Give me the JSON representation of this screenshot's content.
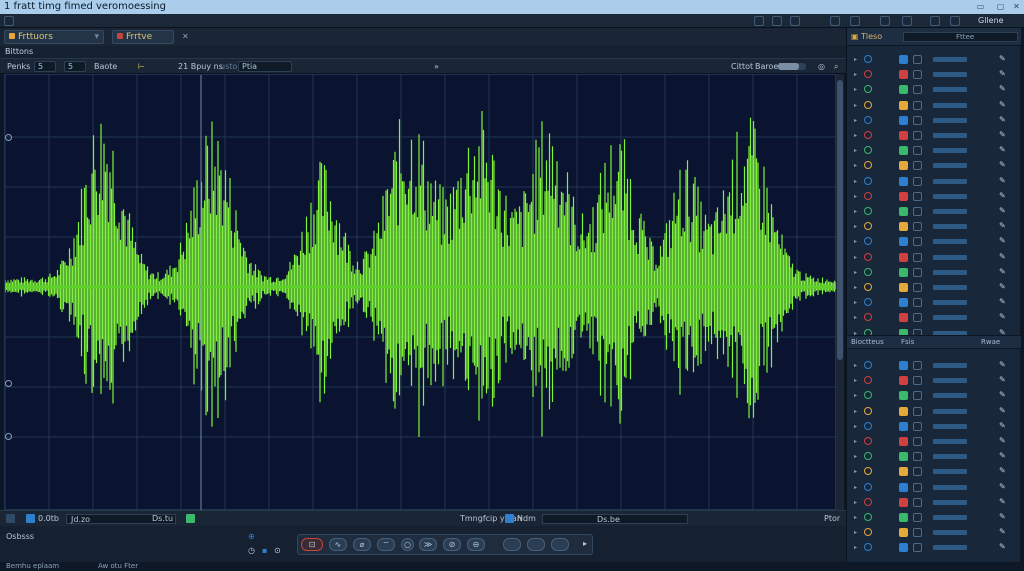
{
  "window": {
    "title": "1 fratt timg fimed veromoessing",
    "right_label": "Gllene"
  },
  "tabs": [
    {
      "label": "Frttuors"
    },
    {
      "label": "Frrtve"
    }
  ],
  "subheader": {
    "label": "Bittons"
  },
  "toolbar": {
    "left_label": "Penks",
    "field1": "5",
    "field2": "5",
    "field3_label": "Baote",
    "position_label": "21 Bpuy ns",
    "position_value": "usto",
    "field5": "Ptia",
    "right_label1": "Cittot",
    "right_label2": "Baroel",
    "volume_fraction": 0.75
  },
  "waveform": {
    "color": "#7ff23a",
    "background": "#0a1430",
    "grid_color": "#233656"
  },
  "statusbar": {
    "left_value": "0.0tb",
    "field_a": "Jd.zo",
    "field_b": "Ds.tu",
    "mid_label": "Tmngfcip yplan",
    "mid_value": "Ndm",
    "right_value": "Ds.be",
    "far_right": "Ptor"
  },
  "transport": {
    "left_label": "Osbsss"
  },
  "bottombar": {
    "text1": "Bemhu eplaam",
    "text2": "Aw otu Fter"
  },
  "right_panel": {
    "header_label": "Tleso",
    "header_value": "Fttee",
    "divider_label": "Bioctteus",
    "divider_value": "Fsis",
    "sub_label": "Rwae"
  },
  "colors": {
    "accent_orange": "#e5a83a",
    "accent_blue": "#2f7fd1",
    "accent_green": "#3bb86b",
    "accent_red": "#d04040"
  }
}
